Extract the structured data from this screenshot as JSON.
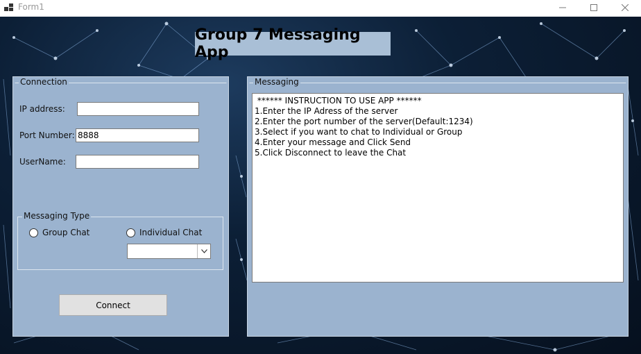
{
  "window": {
    "title": "Form1",
    "controls": [
      "minimize-icon",
      "maximize-icon",
      "close-icon"
    ]
  },
  "heading": "Group 7 Messaging App",
  "connection": {
    "group_label": "Connection",
    "ip_label": "IP address:",
    "ip_value": "",
    "port_label": "Port Number:",
    "port_value": "8888",
    "username_label": "UserName:",
    "username_value": "",
    "messaging_type": {
      "group_label": "Messaging Type",
      "group_chat_label": "Group Chat",
      "individual_chat_label": "Individual Chat",
      "selected": null,
      "combo_value": ""
    },
    "connect_label": "Connect"
  },
  "messaging": {
    "group_label": "Messaging",
    "lines": [
      " ****** INSTRUCTION TO USE APP ******",
      "1.Enter the IP Adress of the server",
      "2.Enter the port number of the server(Default:1234)",
      "3.Select if you want to chat to Individual or Group",
      "4.Enter your message and Click Send",
      "5.Click Disconnect to leave the Chat"
    ]
  },
  "colors": {
    "panel": "#9bb3cf",
    "heading_bg": "#a9bfd6",
    "background": "#0c1f36"
  }
}
